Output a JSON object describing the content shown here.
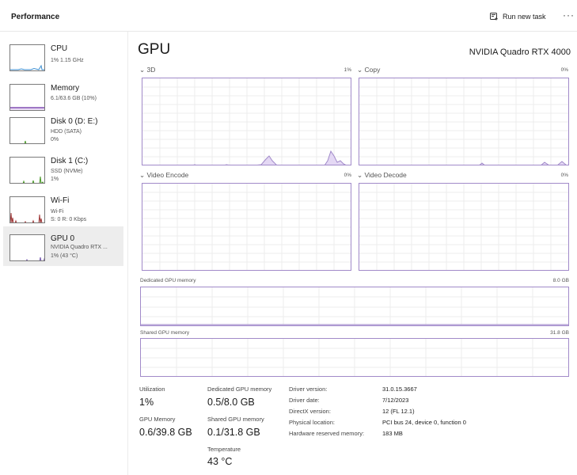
{
  "header": {
    "title": "Performance",
    "run_new_task_label": "Run new task",
    "more_label": "···"
  },
  "sidebar": {
    "items": [
      {
        "name": "CPU",
        "sub1": "1% 1.15 GHz",
        "sub2": "",
        "sub3": ""
      },
      {
        "name": "Memory",
        "sub1": "6.1/63.6 GB (10%)",
        "sub2": "",
        "sub3": ""
      },
      {
        "name": "Disk 0 (D: E:)",
        "sub1": "HDD (SATA)",
        "sub2": "0%",
        "sub3": ""
      },
      {
        "name": "Disk 1 (C:)",
        "sub1": "SSD (NVMe)",
        "sub2": "1%",
        "sub3": ""
      },
      {
        "name": "Wi-Fi",
        "sub1": "Wi-Fi",
        "sub2": "S: 0 R: 0 Kbps",
        "sub3": ""
      },
      {
        "name": "GPU 0",
        "sub1": "NVIDIA Quadro RTX ...",
        "sub2": "1% (43 °C)",
        "sub3": ""
      }
    ],
    "selected_index": 5
  },
  "main": {
    "title": "GPU",
    "model": "NVIDIA Quadro RTX 4000",
    "engines": [
      {
        "label": "3D",
        "percent": "1%"
      },
      {
        "label": "Copy",
        "percent": "0%"
      },
      {
        "label": "Video Encode",
        "percent": "0%"
      },
      {
        "label": "Video Decode",
        "percent": "0%"
      }
    ],
    "dedicated_memory": {
      "label": "Dedicated GPU memory",
      "max": "8.0 GB",
      "used_fraction": 0.0625
    },
    "shared_memory": {
      "label": "Shared GPU memory",
      "max": "31.8 GB",
      "used_fraction": 0.003
    },
    "stats": {
      "utilization": {
        "label": "Utilization",
        "value": "1%"
      },
      "dedicated_gpu_memory": {
        "label": "Dedicated GPU memory",
        "value": "0.5/8.0 GB"
      },
      "gpu_memory": {
        "label": "GPU Memory",
        "value": "0.6/39.8 GB"
      },
      "shared_gpu_memory": {
        "label": "Shared GPU memory",
        "value": "0.1/31.8 GB"
      },
      "temperature": {
        "label": "Temperature",
        "value": "43 °C"
      }
    },
    "info": [
      {
        "key": "Driver version:",
        "value": "31.0.15.3667"
      },
      {
        "key": "Driver date:",
        "value": "7/12/2023"
      },
      {
        "key": "DirectX version:",
        "value": "12 (FL 12.1)"
      },
      {
        "key": "Physical location:",
        "value": "PCI bus 24, device 0, function 0"
      },
      {
        "key": "Hardware reserved memory:",
        "value": "183 MB"
      }
    ]
  },
  "colors": {
    "gpu_accent": "#a18ac9",
    "gpu_fill": "#e4d8f4",
    "cpu_line": "#3f8fd0",
    "memory_line": "#6a2fa3",
    "disk_line": "#4c9a2a",
    "wifi_line": "#a03a3a",
    "grid": "#e6e6e6"
  }
}
